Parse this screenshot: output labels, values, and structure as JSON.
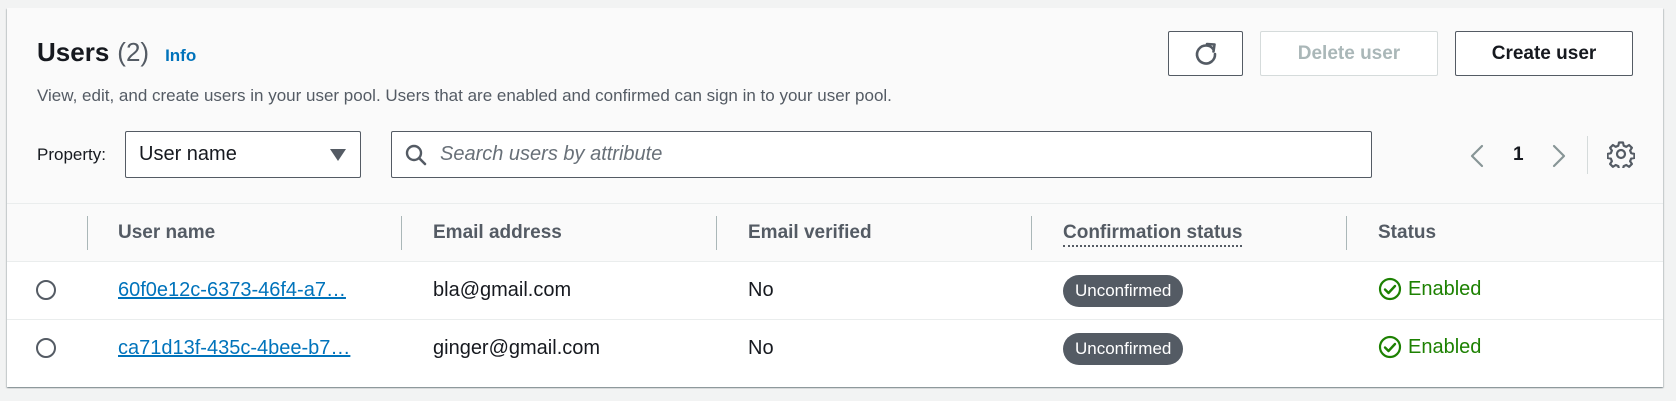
{
  "header": {
    "title": "Users",
    "count": "(2)",
    "info_label": "Info",
    "description": "View, edit, and create users in your user pool. Users that are enabled and confirmed can sign in to your user pool."
  },
  "actions": {
    "refresh_icon": "refresh-icon",
    "delete_label": "Delete user",
    "create_label": "Create user"
  },
  "filter": {
    "property_label": "Property:",
    "property_value": "User name",
    "search_placeholder": "Search users by attribute"
  },
  "pagination": {
    "current_page": "1"
  },
  "table": {
    "columns": [
      "User name",
      "Email address",
      "Email verified",
      "Confirmation status",
      "Status"
    ],
    "rows": [
      {
        "user_name": "60f0e12c-6373-46f4-a7…",
        "email": "bla@gmail.com",
        "email_verified": "No",
        "confirmation_status": "Unconfirmed",
        "status": "Enabled"
      },
      {
        "user_name": "ca71d13f-435c-4bee-b7…",
        "email": "ginger@gmail.com",
        "email_verified": "No",
        "confirmation_status": "Unconfirmed",
        "status": "Enabled"
      }
    ]
  },
  "colors": {
    "link": "#0073bb",
    "enabled": "#1d8102",
    "badge": "#545b64"
  }
}
